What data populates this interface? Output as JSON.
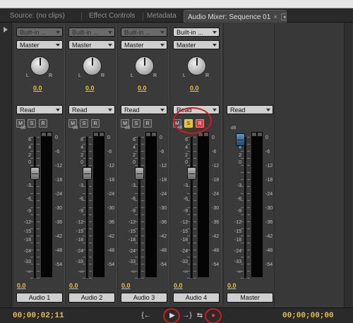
{
  "tabs": [
    {
      "label": "Source: (no clips)"
    },
    {
      "label": "Effect Controls"
    },
    {
      "label": "Metadata"
    },
    {
      "label": "Audio Mixer: Sequence 01"
    }
  ],
  "tab_more": "»",
  "tab_close": "×",
  "tab_menu": "▾",
  "dropdown_builtin": "Built-in ...",
  "dropdown_master": "Master",
  "pan_left_label": "L",
  "pan_right_label": "R",
  "automation_mode": "Read",
  "mute_label": "M",
  "solo_label": "S",
  "record_label": "R",
  "db_label": "dB",
  "left_scale": [
    "6",
    "4",
    "2",
    "0",
    "-3",
    "-6",
    "-9",
    "-12",
    "-15",
    "-18",
    "-24",
    "-33",
    "-∞"
  ],
  "right_scale": [
    "0",
    "-6",
    "-12",
    "-18",
    "-24",
    "-30",
    "-36",
    "-42",
    "-48",
    "-54"
  ],
  "tracks": [
    {
      "name": "Audio 1",
      "pan": "0.0",
      "volume": "0.0"
    },
    {
      "name": "Audio 2",
      "pan": "0.0",
      "volume": "0.0"
    },
    {
      "name": "Audio 3",
      "pan": "0.0",
      "volume": "0.0"
    },
    {
      "name": "Audio 4",
      "pan": "0.0",
      "volume": "0.0"
    }
  ],
  "master": {
    "name": "Master",
    "volume": "0.0"
  },
  "timecode_left": "00;00;02;11",
  "timecode_right": "00;00;00;00",
  "transport": {
    "to_in": "{←",
    "out": "→}",
    "play": "▶",
    "loop": "⇆",
    "loop_toggle": "↻",
    "record": "●"
  }
}
